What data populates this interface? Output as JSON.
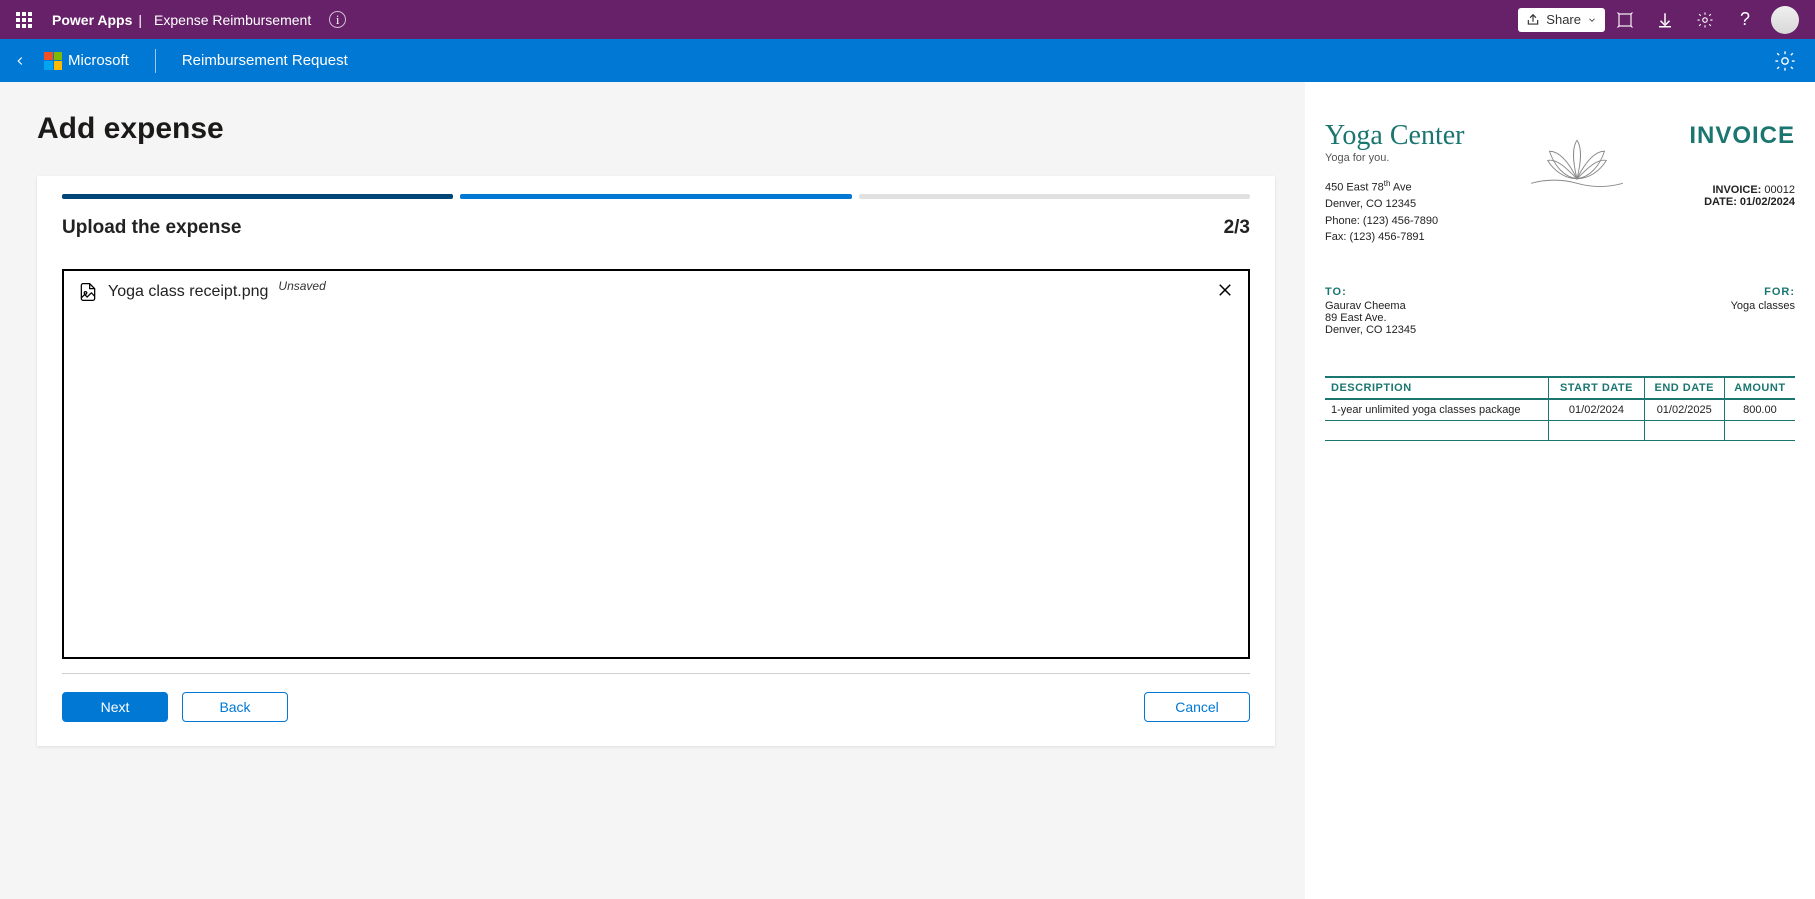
{
  "ribbon": {
    "app": "Power Apps",
    "doc": "Expense Reimbursement",
    "share": "Share"
  },
  "appbar": {
    "brand": "Microsoft",
    "title": "Reimbursement Request"
  },
  "page": {
    "heading": "Add expense"
  },
  "step": {
    "title": "Upload the expense",
    "count": "2/3"
  },
  "file": {
    "name": "Yoga class receipt.png",
    "status": "Unsaved"
  },
  "buttons": {
    "next": "Next",
    "back": "Back",
    "cancel": "Cancel"
  },
  "invoice": {
    "brand": "Yoga Center",
    "tagline": "Yoga for you.",
    "title": "INVOICE",
    "addr_line1_pre": "450 East 78",
    "addr_line1_sup": "th",
    "addr_line1_post": " Ave",
    "addr_line2": "Denver, CO 12345",
    "phone": "Phone: (123) 456-7890",
    "fax": "Fax: (123) 456-7891",
    "inv_label": "INVOICE:",
    "inv_num": " 00012",
    "date_label": "DATE:",
    "date_val": " 01/02/2024",
    "to_label": "TO:",
    "to_name": "Gaurav Cheema",
    "to_addr1": "89 East Ave.",
    "to_addr2": "Denver, CO 12345",
    "for_label": "FOR:",
    "for_val": "Yoga classes",
    "cols": {
      "desc": "DESCRIPTION",
      "start": "START DATE",
      "end": "END DATE",
      "amount": "AMOUNT"
    },
    "row": {
      "desc": "1-year unlimited yoga classes package",
      "start": "01/02/2024",
      "end": "01/02/2025",
      "amount": "800.00"
    }
  }
}
